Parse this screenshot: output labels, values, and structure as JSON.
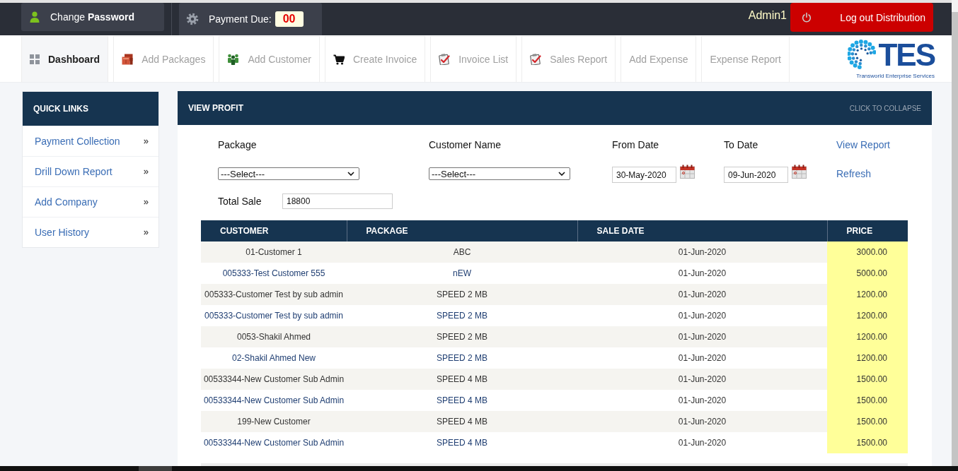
{
  "top_bar": {
    "change_password": "Change **Password**",
    "payment_due": {
      "label": "Payment Due:",
      "value": "00"
    },
    "user": "Admin1",
    "logout": "Log out Distribution"
  },
  "nav": {
    "tabs": [
      {
        "label": "Dashboard",
        "selected": true
      },
      {
        "label": "Add Packages",
        "selected": false
      },
      {
        "label": "Add Customer",
        "selected": false
      },
      {
        "label": "Create Invoice",
        "selected": false
      },
      {
        "label": "Invoice List",
        "selected": false
      },
      {
        "label": "Sales Report",
        "selected": false
      },
      {
        "label": "Add Expense",
        "selected": false
      },
      {
        "label": "Expense Report",
        "selected": false
      }
    ],
    "logo": {
      "text": "TES",
      "tagline": "Transworld Enterprise Services"
    }
  },
  "quick_links": {
    "title": "QUICK LINKS",
    "items": [
      "Payment Collection",
      "Drill Down Report",
      "Add Company",
      "User History"
    ]
  },
  "view_profit": {
    "title": "VIEW PROFIT",
    "collapse": "CLICK TO COLLAPSE",
    "filters": {
      "package": {
        "label": "Package",
        "value": "---Select---"
      },
      "customer_name": {
        "label": "Customer Name",
        "value": "---Select---"
      },
      "from_date": {
        "label": "From Date",
        "value": "30-May-2020"
      },
      "to_date": {
        "label": "To Date",
        "value": "09-Jun-2020"
      },
      "view_report": "View Report",
      "refresh": "Refresh",
      "total_sale": {
        "label": "Total Sale",
        "value": "18800"
      }
    },
    "table": {
      "columns": [
        "CUSTOMER",
        "PACKAGE",
        "SALE DATE",
        "PRICE"
      ],
      "rows": [
        {
          "customer": "01-Customer 1",
          "package": "ABC",
          "sale_date": "01-Jun-2020",
          "price": "3000.00"
        },
        {
          "customer": "005333-Test Customer 555",
          "package": "nEW",
          "sale_date": "01-Jun-2020",
          "price": "5000.00"
        },
        {
          "customer": "005333-Customer Test by sub admin",
          "package": "SPEED 2 MB",
          "sale_date": "01-Jun-2020",
          "price": "1200.00"
        },
        {
          "customer": "005333-Customer Test by sub admin",
          "package": "SPEED 2 MB",
          "sale_date": "01-Jun-2020",
          "price": "1200.00"
        },
        {
          "customer": "0053-Shakil Ahmed",
          "package": "SPEED 2 MB",
          "sale_date": "01-Jun-2020",
          "price": "1200.00"
        },
        {
          "customer": "02-Shakil Ahmed New",
          "package": "SPEED 2 MB",
          "sale_date": "01-Jun-2020",
          "price": "1200.00"
        },
        {
          "customer": "00533344-New Customer Sub Admin",
          "package": "SPEED 4 MB",
          "sale_date": "01-Jun-2020",
          "price": "1500.00"
        },
        {
          "customer": "00533344-New Customer Sub Admin",
          "package": "SPEED 4 MB",
          "sale_date": "01-Jun-2020",
          "price": "1500.00"
        },
        {
          "customer": "199-New Customer",
          "package": "SPEED 4 MB",
          "sale_date": "01-Jun-2020",
          "price": "1500.00"
        },
        {
          "customer": "00533344-New Customer Sub Admin",
          "package": "SPEED 4 MB",
          "sale_date": "01-Jun-2020",
          "price": "1500.00"
        }
      ]
    }
  }
}
